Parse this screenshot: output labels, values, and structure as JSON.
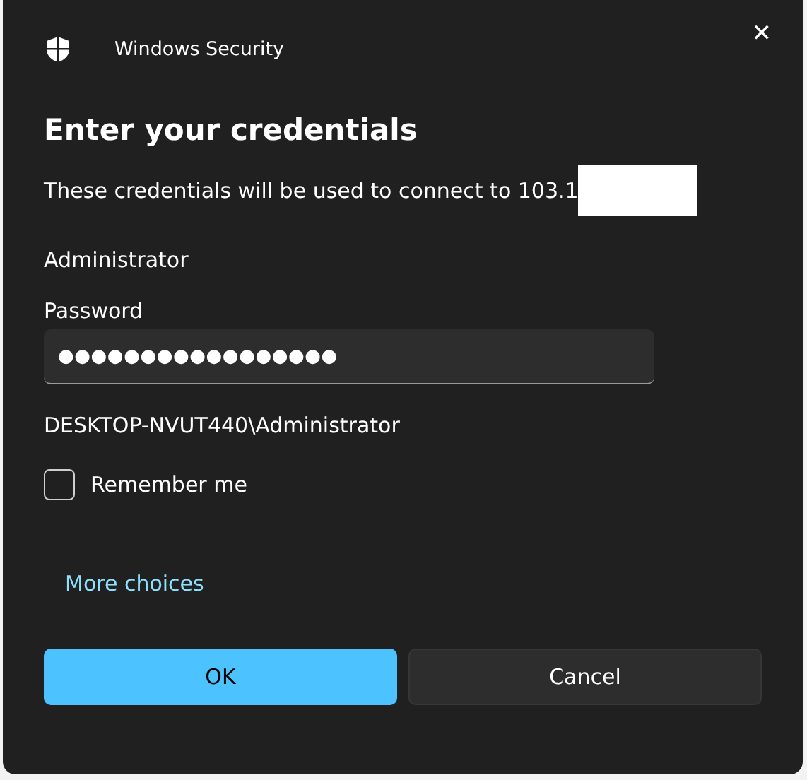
{
  "window": {
    "title": "Windows Security",
    "close": "✕"
  },
  "heading": "Enter your credentials",
  "description": "These credentials will be used to connect to 103.1",
  "username": "Administrator",
  "password": {
    "label": "Password",
    "value": "●●●●●●●●●●●●●●●●●"
  },
  "domain_user": "DESKTOP-NVUT440\\Administrator",
  "remember": {
    "label": "Remember me",
    "checked": false
  },
  "more_choices": "More choices",
  "buttons": [
    {
      "label": "OK",
      "kind": "primary"
    },
    {
      "label": "Cancel",
      "kind": "secondary"
    }
  ]
}
